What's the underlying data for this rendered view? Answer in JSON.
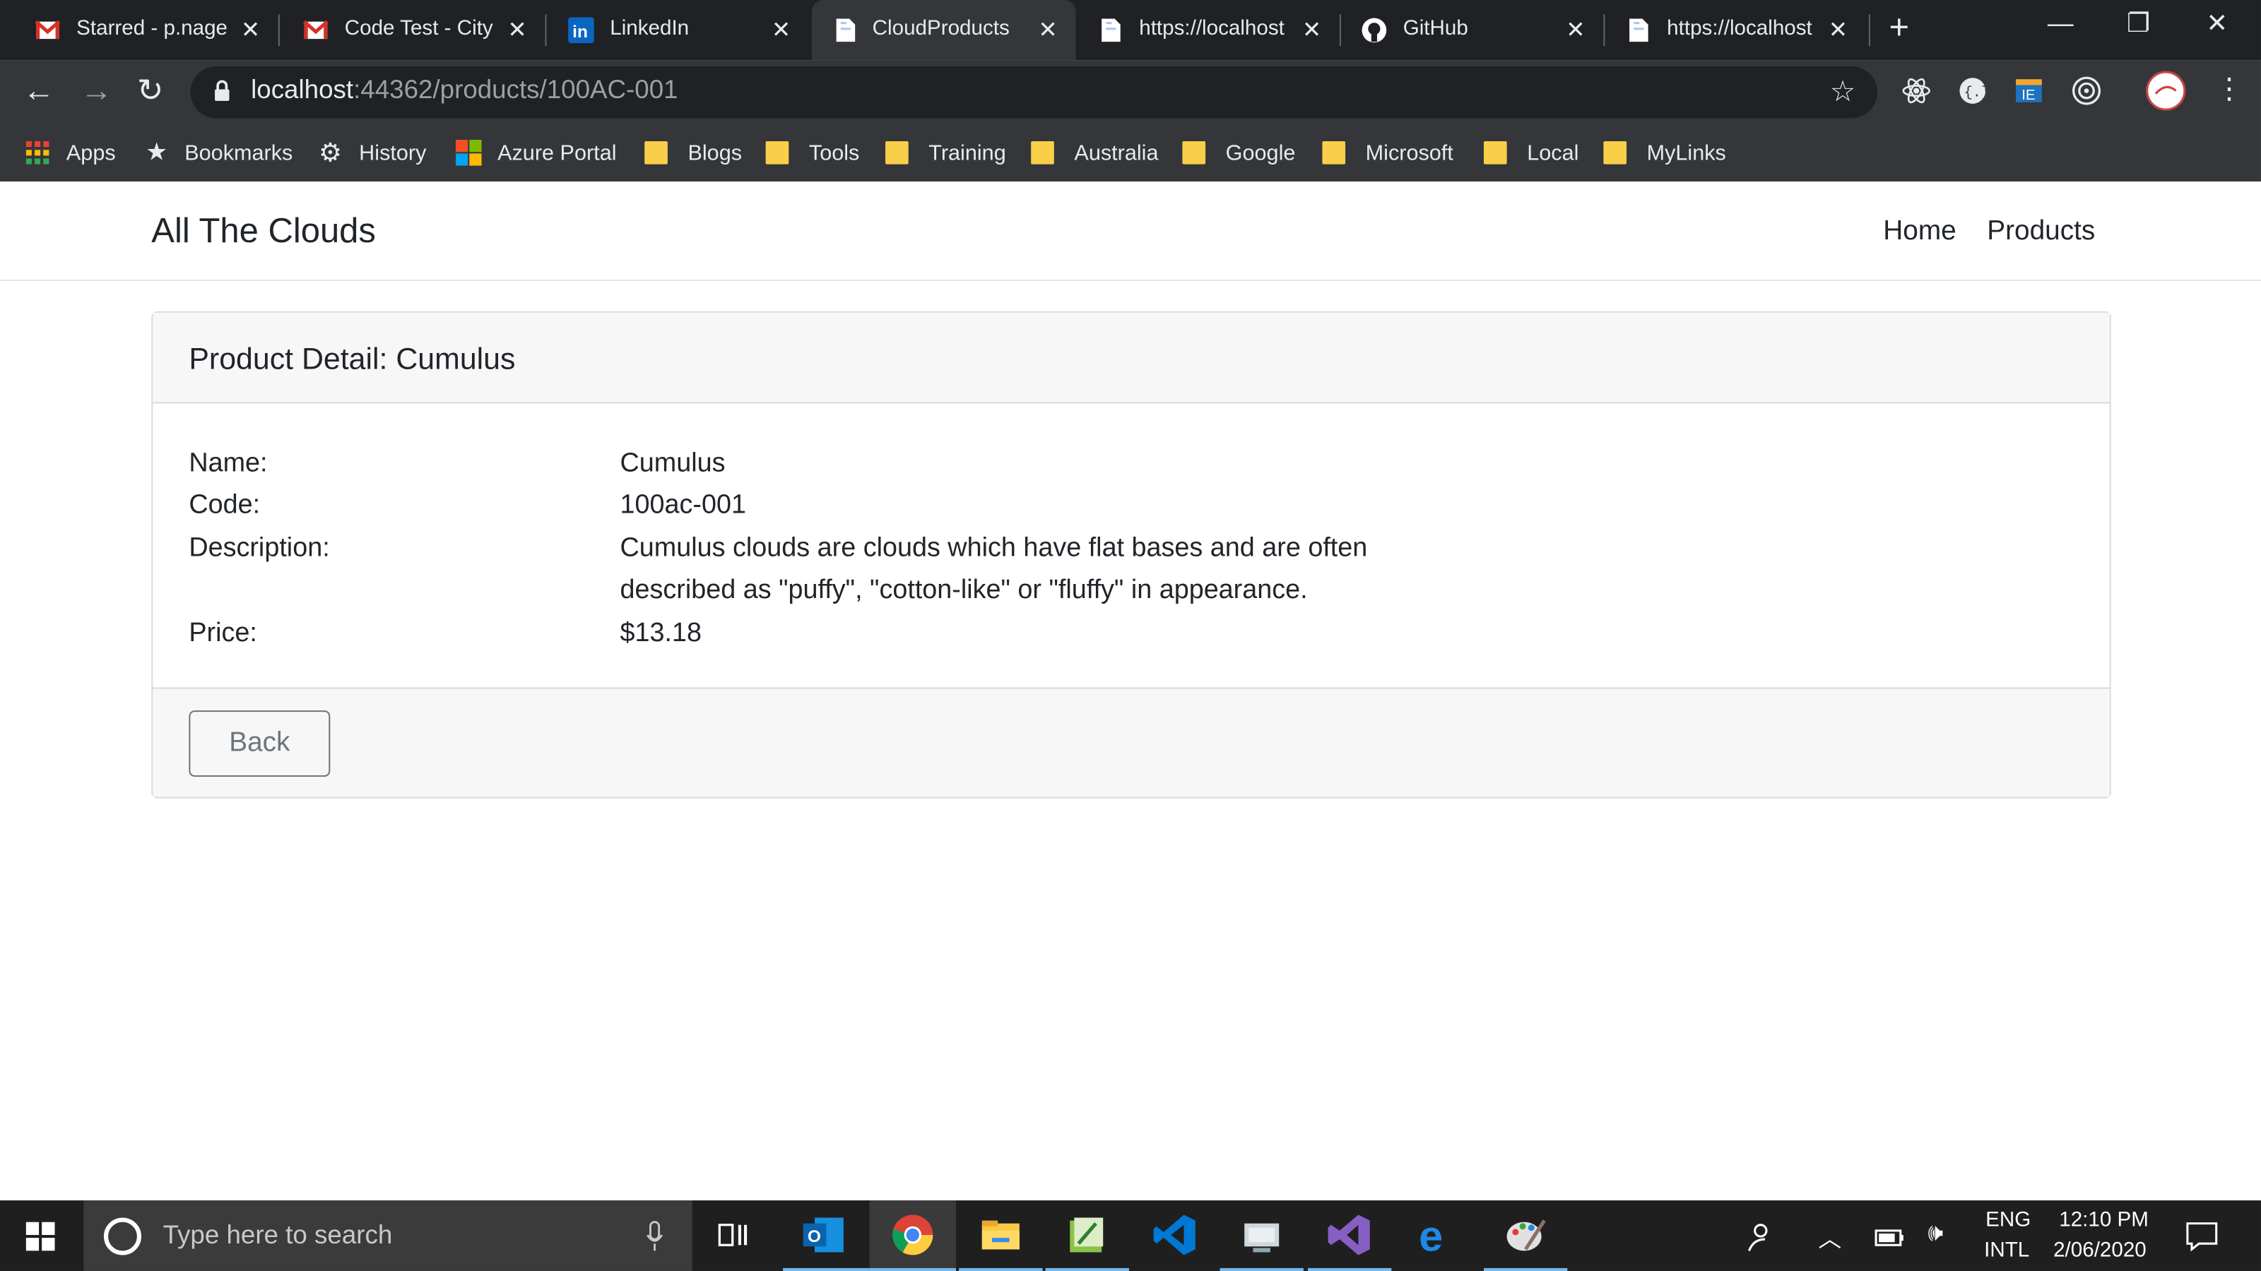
{
  "browser": {
    "tabs": [
      {
        "title": "Starred - p.nage",
        "favicon": "gmail-icon",
        "active": false
      },
      {
        "title": "Code Test - City",
        "favicon": "gmail-icon",
        "active": false
      },
      {
        "title": "LinkedIn",
        "favicon": "linkedin-icon",
        "active": false
      },
      {
        "title": "CloudProducts",
        "favicon": "page-icon",
        "active": true
      },
      {
        "title": "https://localhost",
        "favicon": "page-icon",
        "active": false
      },
      {
        "title": "GitHub",
        "favicon": "github-icon",
        "active": false
      },
      {
        "title": "https://localhost",
        "favicon": "page-icon",
        "active": false
      }
    ],
    "url_host": "localhost",
    "url_path": ":44362/products/100AC-001",
    "bookmarks": [
      {
        "label": "Apps",
        "icon": "apps-grid-icon"
      },
      {
        "label": "Bookmarks",
        "icon": "star-icon"
      },
      {
        "label": "History",
        "icon": "gear-icon"
      },
      {
        "label": "Azure Portal",
        "icon": "microsoft-logo-icon"
      },
      {
        "label": "Blogs",
        "icon": "folder-icon"
      },
      {
        "label": "Tools",
        "icon": "folder-icon"
      },
      {
        "label": "Training",
        "icon": "folder-icon"
      },
      {
        "label": "Australia",
        "icon": "folder-icon"
      },
      {
        "label": "Google",
        "icon": "folder-icon"
      },
      {
        "label": "Microsoft",
        "icon": "folder-icon"
      },
      {
        "label": "Local",
        "icon": "folder-icon"
      },
      {
        "label": "MyLinks",
        "icon": "folder-icon"
      }
    ]
  },
  "site": {
    "brand": "All The Clouds",
    "nav": {
      "home": "Home",
      "products": "Products"
    }
  },
  "product": {
    "header": "Product Detail: Cumulus",
    "labels": {
      "name": "Name:",
      "code": "Code:",
      "description": "Description:",
      "price": "Price:"
    },
    "name": "Cumulus",
    "code": "100ac-001",
    "description_line1": "Cumulus clouds are clouds which have flat bases and are often",
    "description_line2": "described as \"puffy\", \"cotton-like\" or \"fluffy\" in appearance.",
    "price": "$13.18",
    "back_label": "Back"
  },
  "taskbar": {
    "search_placeholder": "Type here to search",
    "lang1": "ENG",
    "lang2": "INTL",
    "time": "12:10 PM",
    "date": "2/06/2020"
  },
  "colors": {
    "chrome_dark": "#202124",
    "chrome_toolbar": "#35363a",
    "taskbar": "#1f1f1f",
    "text": "#212529",
    "button_secondary": "#6c757d"
  }
}
